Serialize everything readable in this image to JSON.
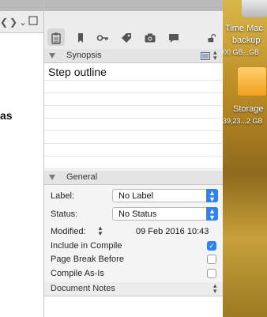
{
  "editor": {
    "text_fragment": "as"
  },
  "inspector": {
    "tabs": [
      {
        "icon": "notes-icon"
      },
      {
        "icon": "bookmark-icon"
      },
      {
        "icon": "key-icon"
      },
      {
        "icon": "tag-icon"
      },
      {
        "icon": "camera-icon"
      },
      {
        "icon": "comment-icon"
      },
      {
        "icon": "lock-icon"
      }
    ],
    "synopsis": {
      "header": "Synopsis",
      "text": "Step outline"
    },
    "general": {
      "header": "General",
      "label_caption": "Label:",
      "label_value": "No Label",
      "status_caption": "Status:",
      "status_value": "No Status",
      "modified_caption": "Modified:",
      "modified_value": "09 Feb 2016 10:43",
      "include_in_compile": {
        "label": "Include in Compile",
        "checked": true
      },
      "page_break_before": {
        "label": "Page Break Before",
        "checked": false
      },
      "compile_as_is": {
        "label": "Compile As-Is",
        "checked": false
      }
    },
    "document_notes": {
      "header": "Document Notes"
    }
  },
  "desktop": {
    "drives": [
      {
        "name_line1": "Time Mac",
        "name_line2": "backup",
        "size": "00 GB...GB"
      },
      {
        "name_line1": "Storage",
        "size": "39,23...2 GB"
      }
    ]
  },
  "colors": {
    "accent": "#2d83f3",
    "section_header": "#e4e4e4",
    "desktop_wood": "#b98a25"
  }
}
